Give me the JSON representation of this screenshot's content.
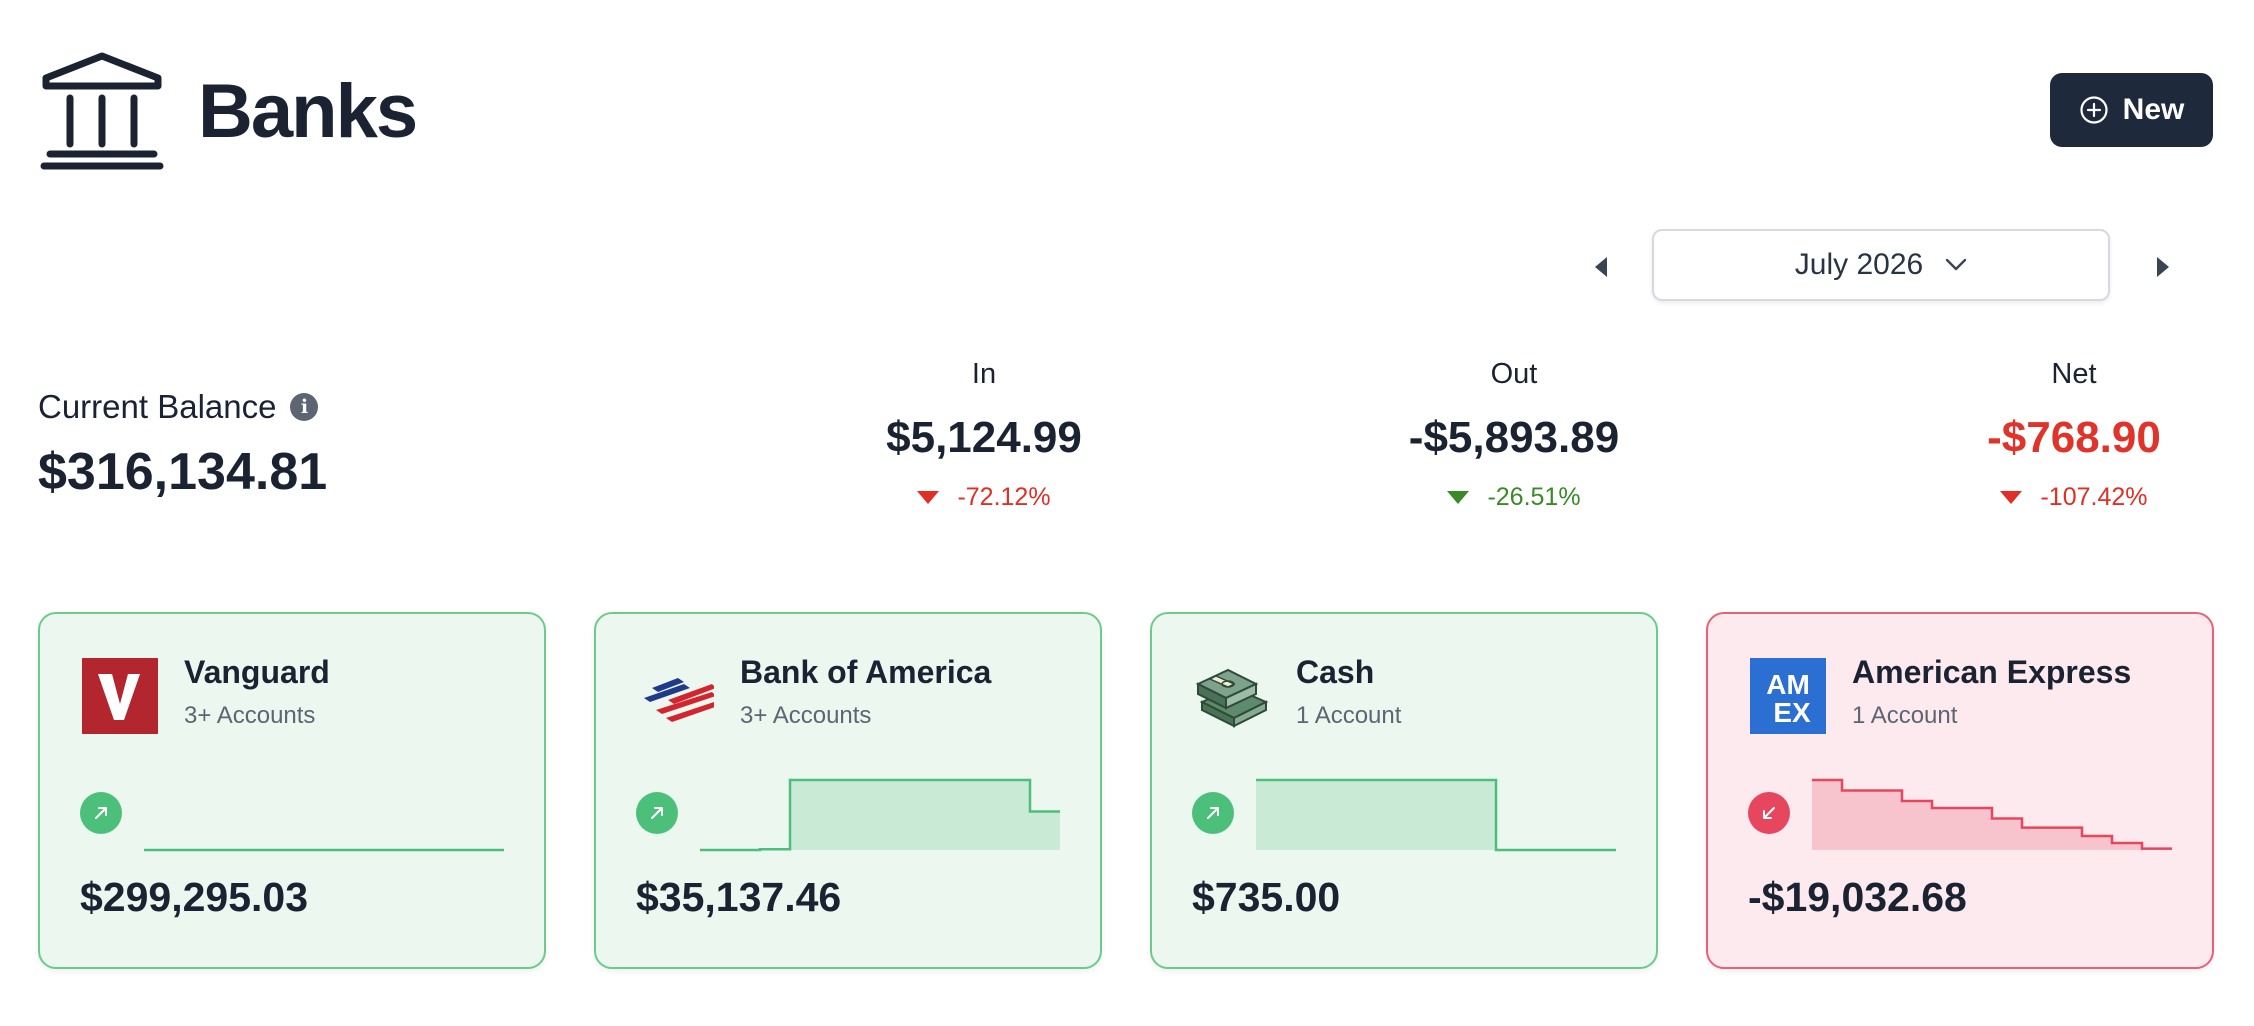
{
  "header": {
    "title": "Banks",
    "bank_icon": "bank-building-icon",
    "new_button": {
      "label": "New",
      "icon": "plus-circle-icon"
    }
  },
  "period": {
    "selected": "July 2026",
    "prev_icon": "caret-left-icon",
    "next_icon": "caret-right-icon",
    "dropdown_icon": "chevron-down-icon"
  },
  "balance": {
    "label": "Current Balance",
    "info_icon": "info-icon",
    "value": "$316,134.81"
  },
  "stats": [
    {
      "label": "In",
      "value": "$5,124.99",
      "change": "-72.12%",
      "direction": "down",
      "value_color": "#1b2333",
      "change_color": "#e02f25"
    },
    {
      "label": "Out",
      "value": "-$5,893.89",
      "change": "-26.51%",
      "direction": "down",
      "value_color": "#1b2333",
      "change_color": "#3a8a28"
    },
    {
      "label": "Net",
      "value": "-$768.90",
      "change": "-107.42%",
      "direction": "down",
      "value_color": "#e0332a",
      "change_color": "#e02f25"
    }
  ],
  "banks": [
    {
      "name": "Vanguard",
      "accounts": "3+ Accounts",
      "amount": "$299,295.03",
      "trend": "up",
      "logo": "vanguard-logo",
      "sparkline": [
        0,
        0,
        0,
        0,
        0,
        0,
        0,
        0,
        0,
        0,
        0,
        0
      ]
    },
    {
      "name": "Bank of America",
      "accounts": "3+ Accounts",
      "amount": "$35,137.46",
      "trend": "up",
      "logo": "bank-of-america-logo",
      "sparkline": [
        0,
        0,
        0.01,
        1,
        1,
        1,
        1,
        1,
        1,
        1,
        1,
        0.55
      ]
    },
    {
      "name": "Cash",
      "accounts": "1 Account",
      "amount": "$735.00",
      "trend": "up",
      "logo": "cash-stack-logo",
      "sparkline": [
        1,
        1,
        1,
        1,
        1,
        1,
        1,
        1,
        0,
        0,
        0,
        0
      ]
    },
    {
      "name": "American Express",
      "accounts": "1 Account",
      "amount": "-$19,032.68",
      "trend": "down",
      "logo": "american-express-logo",
      "sparkline": [
        1,
        0.85,
        0.85,
        0.7,
        0.6,
        0.6,
        0.45,
        0.32,
        0.32,
        0.2,
        0.1,
        0.02
      ]
    }
  ],
  "colors": {
    "positive_border": "#6ccb8a",
    "positive_fill": "#ecf7f0",
    "positive_line": "#4cc07a",
    "negative_border": "#e8607a",
    "negative_fill": "#fdeaee",
    "negative_line": "#e6475f",
    "button_bg": "#1e2a3b"
  }
}
